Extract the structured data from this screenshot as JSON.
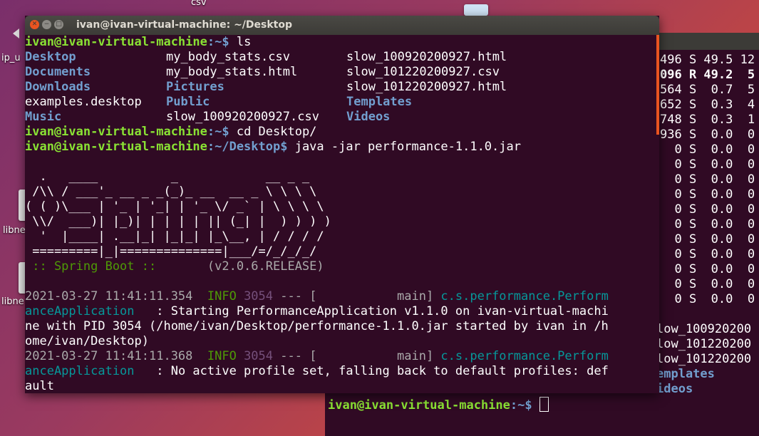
{
  "desktop": {
    "labels": [
      "csv",
      "ip_u",
      "libne",
      "libne"
    ]
  },
  "front_terminal": {
    "title": "ivan@ivan-virtual-machine: ~/Desktop",
    "prompt_user": "ivan@ivan-virtual-machine",
    "prompt_home": ":~$ ",
    "prompt_desktop": ":~/Desktop$ ",
    "cmd_ls": "ls",
    "cmd_cd": "cd Desktop/",
    "cmd_java": "java -jar performance-1.1.0.jar",
    "ls_col1": [
      "Desktop",
      "Documents",
      "Downloads",
      "examples.desktop",
      "Music"
    ],
    "ls_col2": [
      "my_body_stats.csv",
      "my_body_stats.html",
      "Pictures",
      "Public",
      "slow_100920200927.csv"
    ],
    "ls_col3": [
      "slow_100920200927.html",
      "slow_101220200927.csv",
      "slow_101220200927.html",
      "Templates",
      "Videos"
    ],
    "banner": [
      "  .   ____          _            __ _ _",
      " /\\\\ / ___'_ __ _ _(_)_ __  __ _ \\ \\ \\ \\",
      "( ( )\\___ | '_ | '_| | '_ \\/ _` | \\ \\ \\ \\",
      " \\\\/  ___)| |_)| | | | | || (_| |  ) ) ) )",
      "  '  |____| .__|_| |_|_| |_\\__, | / / / /",
      " =========|_|==============|___/=/_/_/_/"
    ],
    "spring_label": " :: Spring Boot :: ",
    "spring_version": "      (v2.0.6.RELEASE)",
    "log1_time": "2021-03-27 11:41:11.354  ",
    "log1_level": "INFO",
    "log1_pid": " 3054",
    "log1_sep": " --- [           main] ",
    "log1_logger_a": "c.s.performance.Perform",
    "log1_logger_b": "anceApplication",
    "log1_msg_a": "   : Starting PerformanceApplication v1.1.0 on ivan-virtual-machi",
    "log1_msg_b": "ne with PID 3054 (/home/ivan/Desktop/performance-1.1.0.jar started by ivan in /h",
    "log1_msg_c": "ome/ivan/Desktop)",
    "log2_time": "2021-03-27 11:41:11.368  ",
    "log2_level": "INFO",
    "log2_pid": " 3054",
    "log2_sep": " --- [           main] ",
    "log2_logger_a": "c.s.performance.Perform",
    "log2_logger_b": "anceApplication",
    "log2_msg_a": "   : No active profile set, falling back to default profiles: def",
    "log2_msg_b": "ault"
  },
  "back_terminal": {
    "top_rows": [
      "496 S 49.5 12",
      "096 R 49.2  5",
      "564 S  0.7  5",
      "652 S  0.3  4",
      "748 S  0.3  1",
      "936 S  0.0  0"
    ],
    "zero_row": "  0 S  0.0  0",
    "file_rows": [
      "low_100920200",
      "low_101220200",
      "low_101220200"
    ],
    "dir_rows": [
      "emplates",
      "ideos"
    ],
    "prompt_user": "ivan@ivan-virtual-machine",
    "prompt_home": ":~$ "
  }
}
